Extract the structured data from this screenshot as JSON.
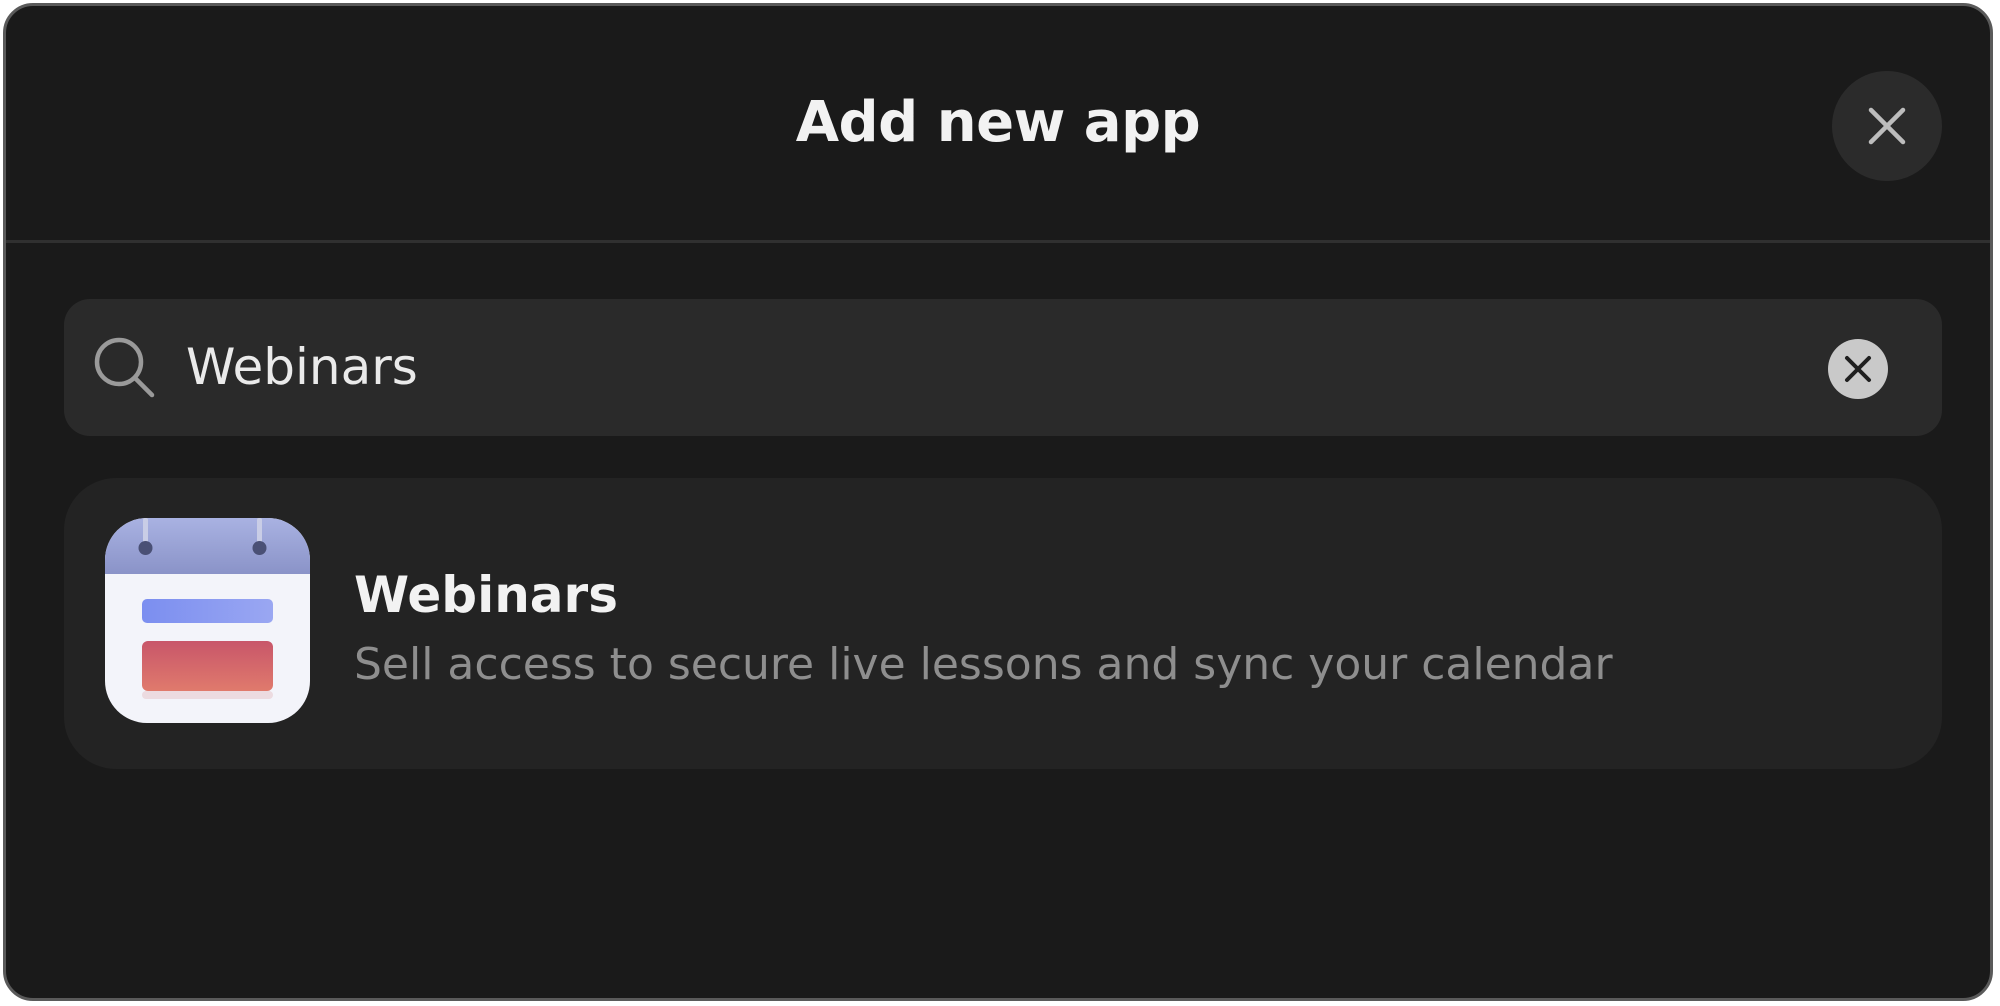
{
  "dialog": {
    "title": "Add new app",
    "close_icon": "close-icon"
  },
  "search": {
    "value": "Webinars",
    "search_icon": "search-icon",
    "clear_icon": "clear-circle-icon"
  },
  "results": [
    {
      "name": "Webinars",
      "description": "Sell access to secure live lessons and sync your calendar",
      "icon": "calendar-app-icon"
    }
  ],
  "colors": {
    "background": "#1a1a1a",
    "search_background": "#2a2a2a",
    "result_background": "#232323",
    "text_primary": "#f2f2f2",
    "text_secondary": "#8e8e8e"
  }
}
